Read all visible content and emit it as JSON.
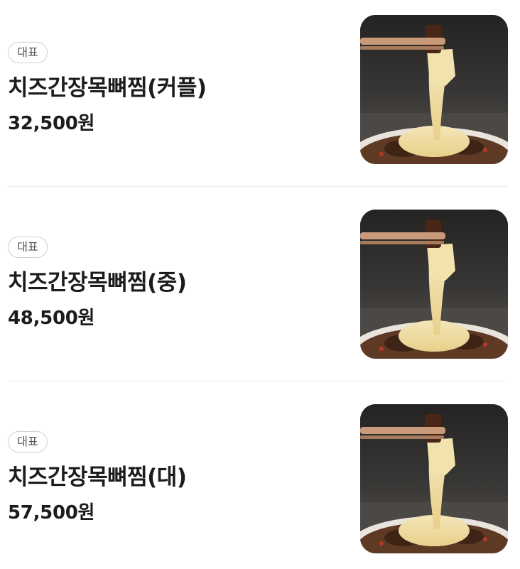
{
  "menu": {
    "items": [
      {
        "badge": "대표",
        "name": "치즈간장목뼈찜(커플)",
        "price": "32,500원"
      },
      {
        "badge": "대표",
        "name": "치즈간장목뼈찜(중)",
        "price": "48,500원"
      },
      {
        "badge": "대표",
        "name": "치즈간장목뼈찜(대)",
        "price": "57,500원"
      }
    ]
  },
  "thumb_icon": "food-photo"
}
